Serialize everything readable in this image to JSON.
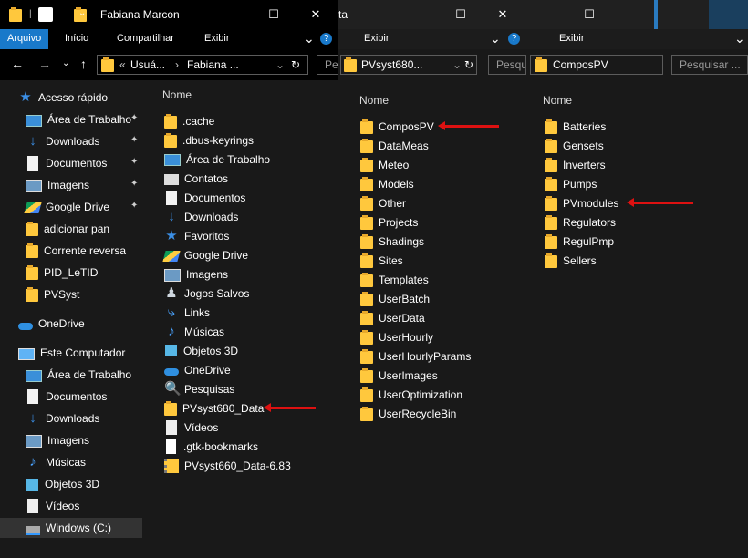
{
  "window1": {
    "title": "Fabiana Marcon",
    "ribbon_tabs": [
      "Arquivo",
      "Início",
      "Compartilhar",
      "Exibir"
    ],
    "address": {
      "prefix": "«",
      "crumb1": "Usuá...",
      "sep": "›",
      "crumb2": "Fabiana ..."
    },
    "search_placeholder": "Pe",
    "column_name": "Nome",
    "sidebar": [
      {
        "label": "Acesso rápido",
        "icon": "star-icon",
        "pinned": false,
        "group": true
      },
      {
        "label": "Área de Trabalho",
        "icon": "desktop-icon",
        "pinned": true
      },
      {
        "label": "Downloads",
        "icon": "download-icon",
        "pinned": true
      },
      {
        "label": "Documentos",
        "icon": "document-icon",
        "pinned": true
      },
      {
        "label": "Imagens",
        "icon": "image-icon",
        "pinned": true
      },
      {
        "label": "Google Drive",
        "icon": "google-drive-icon",
        "pinned": true
      },
      {
        "label": "adicionar pan",
        "icon": "folder-icon",
        "pinned": false
      },
      {
        "label": "Corrente reversa",
        "icon": "folder-icon",
        "pinned": false
      },
      {
        "label": "PID_LeTID",
        "icon": "folder-icon",
        "pinned": false
      },
      {
        "label": "PVSyst",
        "icon": "folder-icon",
        "pinned": false
      },
      {
        "label": "OneDrive",
        "icon": "cloud-icon",
        "pinned": false,
        "group": true
      },
      {
        "label": "Este Computador",
        "icon": "computer-icon",
        "pinned": false,
        "group": true
      },
      {
        "label": "Área de Trabalho",
        "icon": "desktop-icon",
        "pinned": false
      },
      {
        "label": "Documentos",
        "icon": "document-icon",
        "pinned": false
      },
      {
        "label": "Downloads",
        "icon": "download-icon",
        "pinned": false
      },
      {
        "label": "Imagens",
        "icon": "image-icon",
        "pinned": false
      },
      {
        "label": "Músicas",
        "icon": "music-icon",
        "pinned": false
      },
      {
        "label": "Objetos 3D",
        "icon": "cube-icon",
        "pinned": false
      },
      {
        "label": "Vídeos",
        "icon": "video-icon",
        "pinned": false
      },
      {
        "label": "Windows (C:)",
        "icon": "drive-icon",
        "pinned": false,
        "selected": true
      }
    ],
    "files": [
      {
        "label": ".cache",
        "icon": "folder-icon"
      },
      {
        "label": ".dbus-keyrings",
        "icon": "folder-icon"
      },
      {
        "label": "Área de Trabalho",
        "icon": "desktop-icon"
      },
      {
        "label": "Contatos",
        "icon": "contacts-icon"
      },
      {
        "label": "Documentos",
        "icon": "document-icon"
      },
      {
        "label": "Downloads",
        "icon": "download-icon"
      },
      {
        "label": "Favoritos",
        "icon": "star-icon"
      },
      {
        "label": "Google Drive",
        "icon": "google-drive-icon"
      },
      {
        "label": "Imagens",
        "icon": "image-icon"
      },
      {
        "label": "Jogos Salvos",
        "icon": "chess-icon"
      },
      {
        "label": "Links",
        "icon": "link-icon"
      },
      {
        "label": "Músicas",
        "icon": "music-icon"
      },
      {
        "label": "Objetos 3D",
        "icon": "cube-icon"
      },
      {
        "label": "OneDrive",
        "icon": "cloud-icon"
      },
      {
        "label": "Pesquisas",
        "icon": "search-icon"
      },
      {
        "label": "PVsyst680_Data",
        "icon": "folder-icon"
      },
      {
        "label": "Vídeos",
        "icon": "video-icon"
      },
      {
        "label": ".gtk-bookmarks",
        "icon": "file-icon"
      },
      {
        "label": "PVsyst660_Data-6.83",
        "icon": "zip-icon"
      }
    ]
  },
  "window2": {
    "title_fragment": "ta",
    "ribbon_tab": "Exibir",
    "address": "PVsyst680...",
    "search_placeholder": "Pesqu",
    "column_name": "Nome",
    "files": [
      "ComposPV",
      "DataMeas",
      "Meteo",
      "Models",
      "Other",
      "Projects",
      "Shadings",
      "Sites",
      "Templates",
      "UserBatch",
      "UserData",
      "UserHourly",
      "UserHourlyParams",
      "UserImages",
      "UserOptimization",
      "UserRecycleBin"
    ]
  },
  "window3": {
    "ribbon_tab": "Exibir",
    "address": "ComposPV",
    "search_placeholder": "Pesquisar ...",
    "column_name": "Nome",
    "files": [
      "Batteries",
      "Gensets",
      "Inverters",
      "Pumps",
      "PVmodules",
      "Regulators",
      "RegulPmp",
      "Sellers"
    ]
  },
  "icons": {
    "minimize": "—",
    "maximize": "☐",
    "close": "✕",
    "back": "←",
    "forward": "→",
    "dropdown": "⌄",
    "up": "↑",
    "refresh": "↻",
    "help": "?",
    "expand": "⌄",
    "pin": "📌"
  },
  "colors": {
    "accent": "#1979ca",
    "folder": "#ffc83d",
    "arrow": "#dd1111",
    "background": "#191919"
  }
}
